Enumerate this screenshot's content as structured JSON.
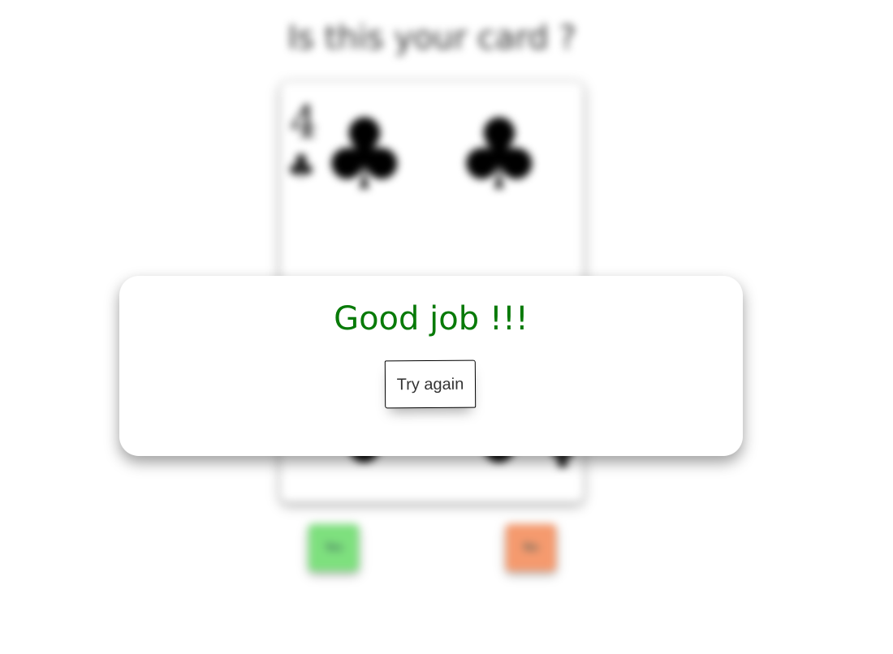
{
  "question": "Is this your card ?",
  "card": {
    "rank": "4",
    "suit_symbol": "♣",
    "suit_name": "clubs",
    "pips": [
      "♣",
      "♣",
      "♣",
      "♣"
    ]
  },
  "answers": {
    "yes_label": "Yes",
    "no_label": "No",
    "yes_color": "#7ee07e",
    "no_color": "#f59a6e"
  },
  "modal": {
    "title": "Good job !!!",
    "title_color": "#087a08",
    "button_label": "Try again"
  }
}
